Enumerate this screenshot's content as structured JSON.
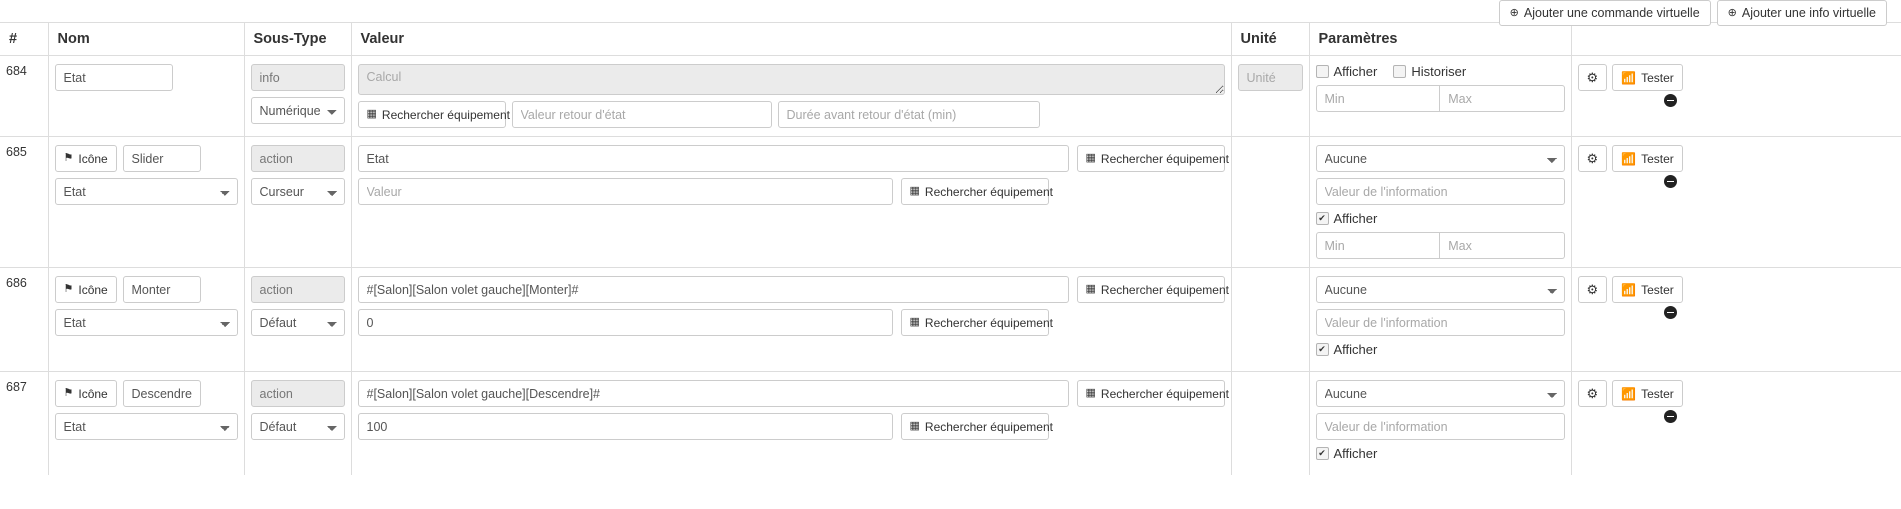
{
  "toolbar": {
    "add_command_label": "Ajouter une commande virtuelle",
    "add_info_label": "Ajouter une info virtuelle",
    "plus_icon": "plus-circle-icon"
  },
  "table": {
    "headers": {
      "num": "#",
      "nom": "Nom",
      "sous_type": "Sous-Type",
      "valeur": "Valeur",
      "unite": "Unité",
      "parametres": "Paramètres",
      "actions": ""
    },
    "common": {
      "icone_label": "Icône",
      "rechercher_label": "Rechercher équipement",
      "tester_label": "Tester",
      "afficher_label": "Afficher",
      "historiser_label": "Historiser",
      "min_placeholder": "Min",
      "max_placeholder": "Max",
      "unite_placeholder": "Unité",
      "calcul_placeholder": "Calcul",
      "valeur_placeholder": "Valeur",
      "valeur_retour_placeholder": "Valeur retour d'état",
      "duree_retour_placeholder": "Durée avant retour d'état (min)",
      "valeur_info_placeholder": "Valeur de l'information"
    },
    "rows": [
      {
        "num": "684",
        "kind": "info",
        "name_value": "Etat",
        "subtype_static": "info",
        "subtype_select": "Numérique",
        "calcul_value": "",
        "unite_value": "",
        "afficher_checked": false,
        "historiser_checked": false,
        "min_value": "",
        "max_value": ""
      },
      {
        "num": "685",
        "kind": "action",
        "icone_label": "Icône",
        "name_value": "Slider",
        "name_select": "Etat",
        "subtype_static": "action",
        "subtype_select": "Curseur",
        "value_main": "Etat",
        "value_second": "",
        "param_select": "Aucune",
        "param_info_value": "",
        "afficher_checked": true,
        "has_minmax": true,
        "min_value": "",
        "max_value": ""
      },
      {
        "num": "686",
        "kind": "action",
        "icone_label": "Icône",
        "name_value": "Monter",
        "name_select": "Etat",
        "subtype_static": "action",
        "subtype_select": "Défaut",
        "value_main": "#[Salon][Salon volet gauche][Monter]#",
        "value_second": "0",
        "param_select": "Aucune",
        "param_info_value": "",
        "afficher_checked": true,
        "has_minmax": false
      },
      {
        "num": "687",
        "kind": "action",
        "icone_label": "Icône",
        "name_value": "Descendre",
        "name_select": "Etat",
        "subtype_static": "action",
        "subtype_select": "Défaut",
        "value_main": "#[Salon][Salon volet gauche][Descendre]#",
        "value_second": "100",
        "param_select": "Aucune",
        "param_info_value": "",
        "afficher_checked": true,
        "has_minmax": false
      }
    ]
  },
  "icons": {
    "flag": "flag-icon",
    "list": "list-icon",
    "signal": "signal-icon",
    "gear": "gear-icon",
    "minus": "minus-circle-icon"
  }
}
